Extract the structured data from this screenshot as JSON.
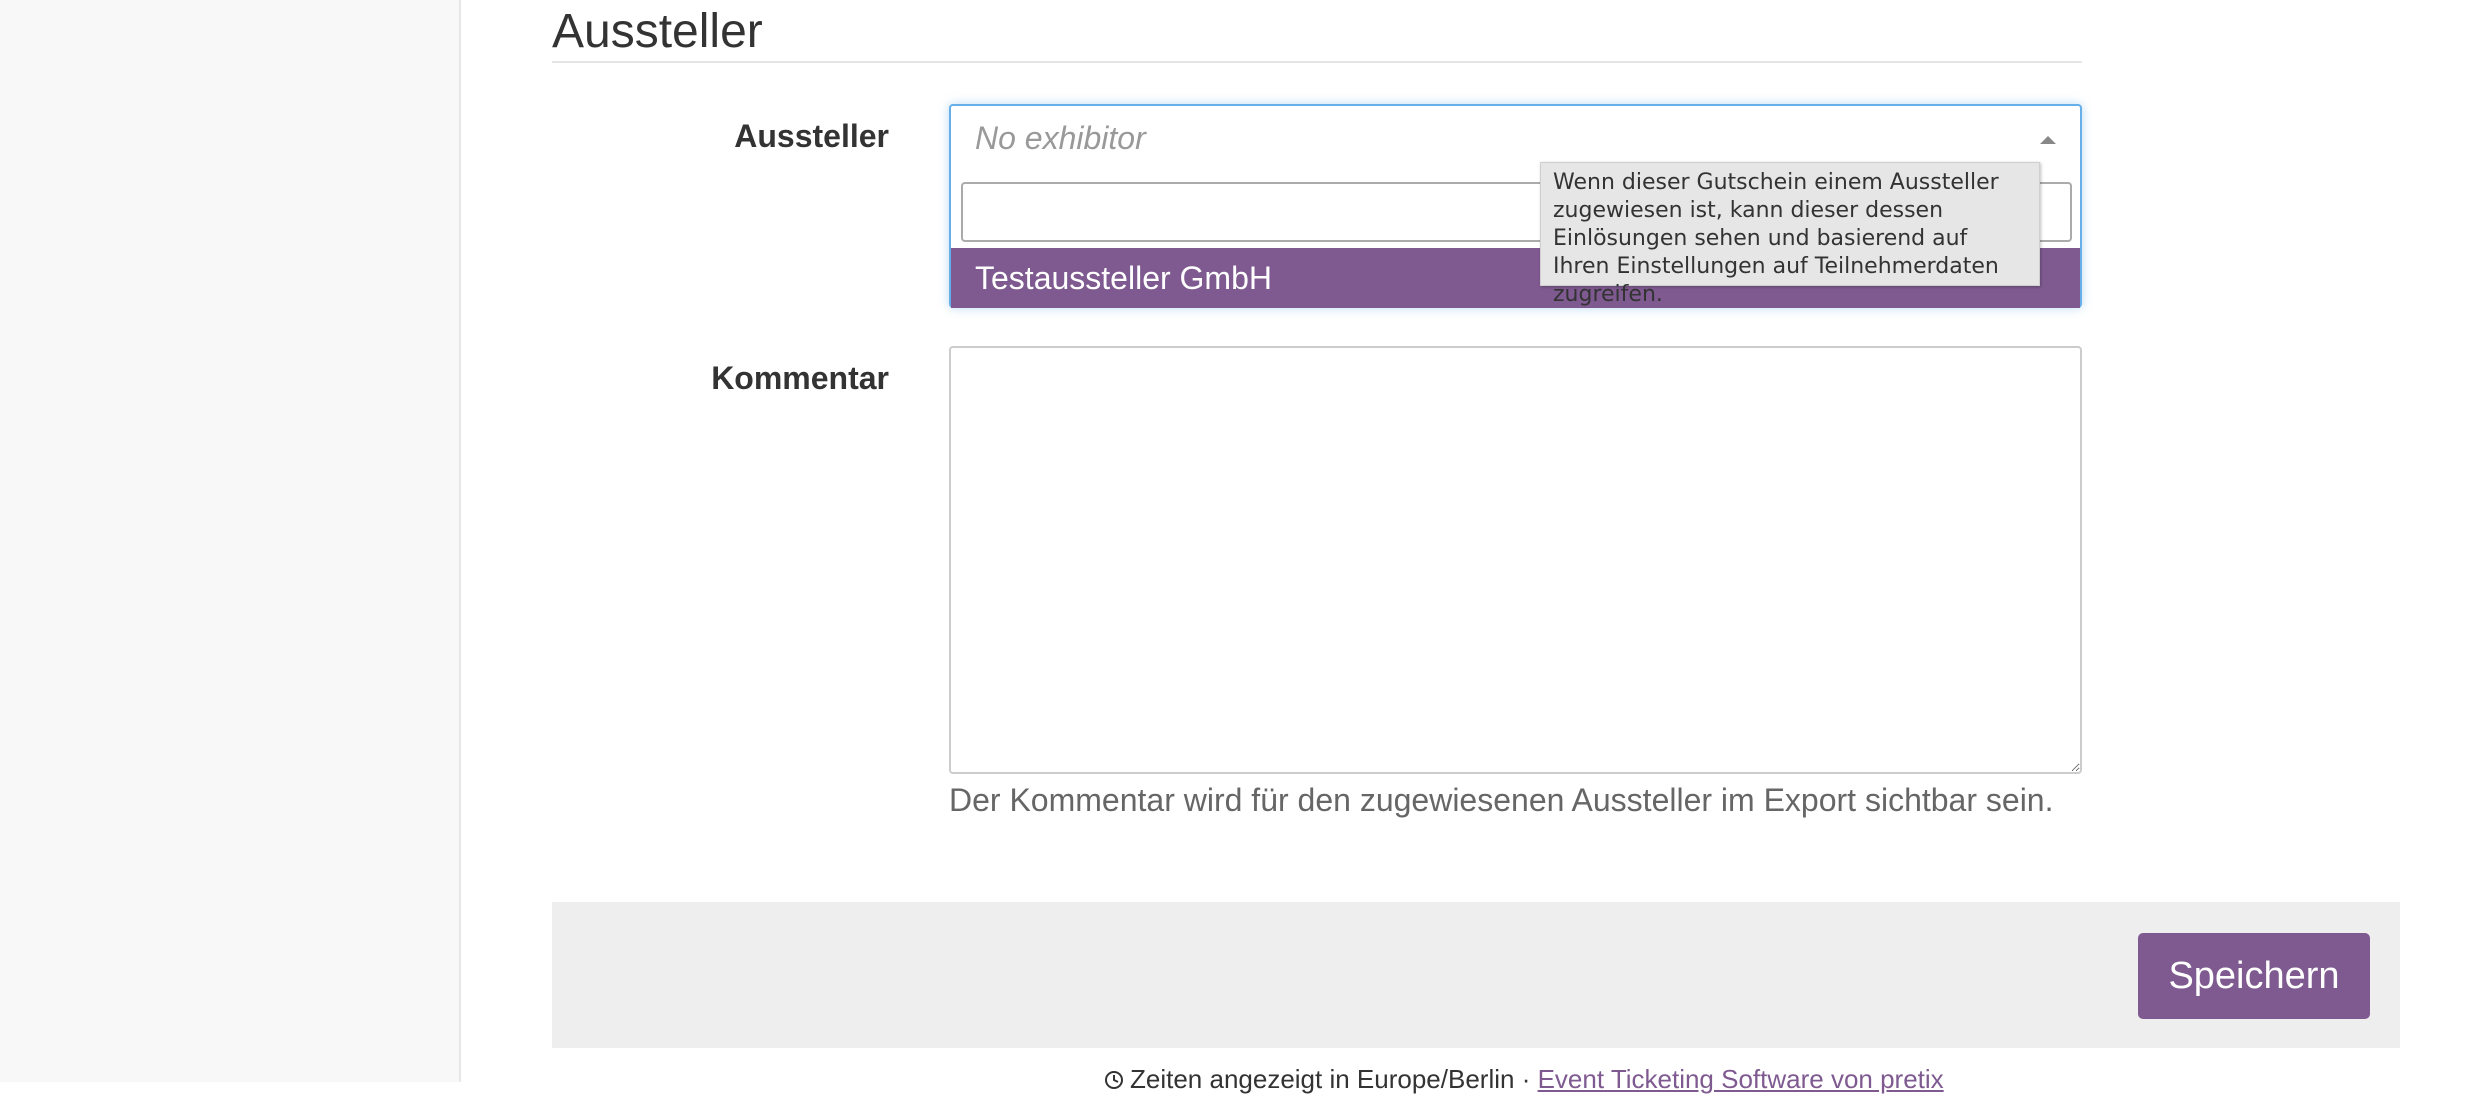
{
  "section": {
    "title": "Aussteller"
  },
  "form": {
    "exhibitor_label": "Aussteller",
    "exhibitor_select": {
      "selected_placeholder": "No exhibitor",
      "search_value": "",
      "options": [
        "Testaussteller GmbH"
      ],
      "highlighted_option": "Testaussteller GmbH"
    },
    "tooltip": "Wenn dieser Gutschein einem Aussteller zugewiesen ist, kann dieser dessen Einlösungen sehen und basierend auf Ihren Einstellungen auf Teilnehmerdaten zugreifen.",
    "comment_label": "Kommentar",
    "comment_value": "",
    "comment_help": "Der Kommentar wird für den zugewiesenen Aussteller im Export sichtbar sein.",
    "save_label": "Speichern"
  },
  "footer": {
    "timezone_text": "Zeiten angezeigt in Europe/Berlin",
    "separator": " · ",
    "link_text": "Event Ticketing Software von pretix"
  },
  "colors": {
    "accent": "#7f5a91",
    "focus": "#66afe9",
    "sidebar_bg": "#f8f8f8",
    "actions_bg": "#eeeeee"
  },
  "icons": {
    "dropdown": "caret-up-icon",
    "footer": "clock-icon"
  }
}
